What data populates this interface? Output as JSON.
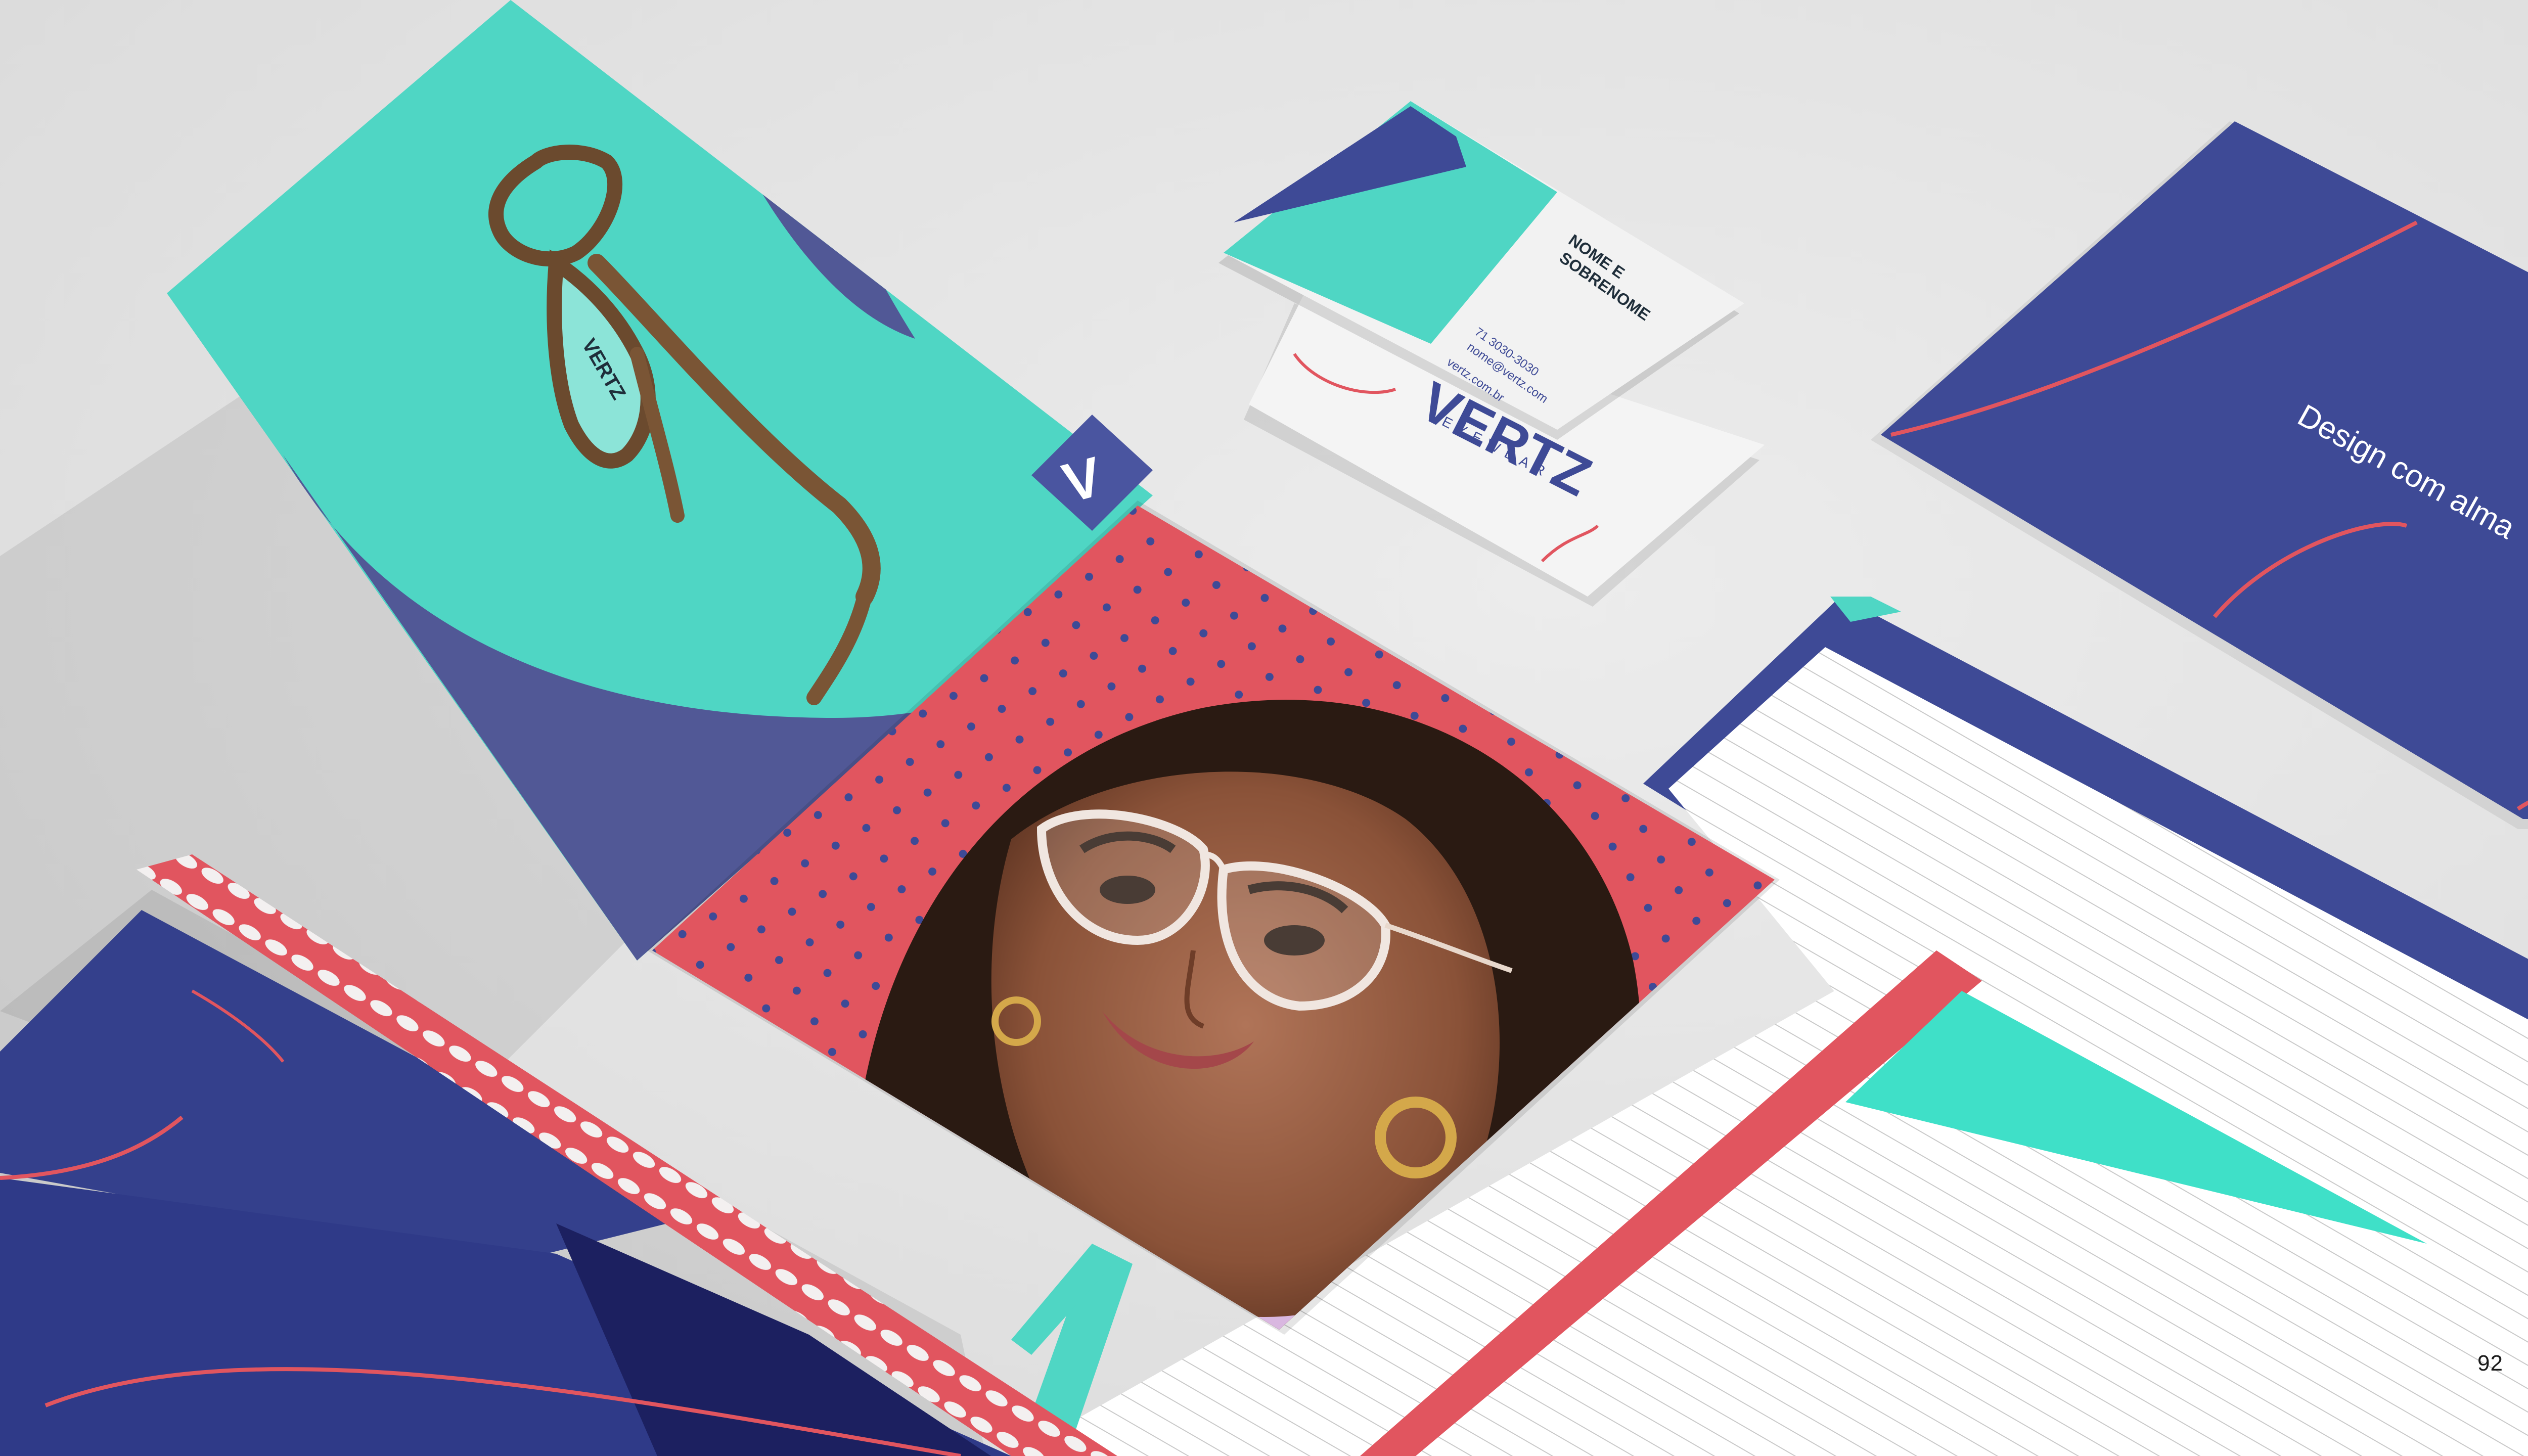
{
  "slide": {
    "page_number": "92",
    "scene": "Vertz Eyewear stationery brand mockup"
  },
  "brand": {
    "logo_mark": "V",
    "frame_engraving": "VERTZ",
    "wordmark": "VERTZ",
    "wordmark_sub": "EYEWEAR"
  },
  "business_card": {
    "name_line_1": "NOME E",
    "name_line_2": "SOBRENOME",
    "phone": "71 3030-3030",
    "email": "nome@vertz.com",
    "website": "vertz.com.br"
  },
  "envelope": {
    "tagline": "Design com alma"
  },
  "colors": {
    "navy": "#3e4a96",
    "navy_dark": "#2e3a86",
    "teal": "#4fd6c4",
    "coral": "#e1555f",
    "paper": "#ffffff",
    "background": "#e4e4e4"
  },
  "icons": {
    "logo": "vertz-v-logo-icon",
    "glasses": "glasses-icon"
  }
}
